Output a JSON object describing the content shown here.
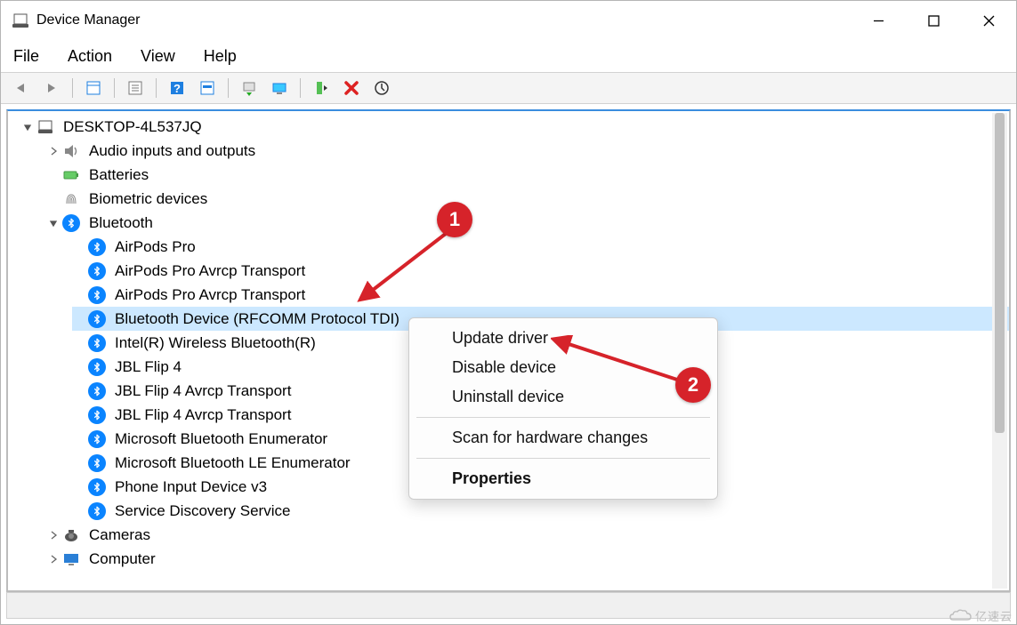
{
  "title": "Device Manager",
  "menubar": [
    "File",
    "Action",
    "View",
    "Help"
  ],
  "root_name": "DESKTOP-4L537JQ",
  "categories": {
    "audio": "Audio inputs and outputs",
    "batteries": "Batteries",
    "biometric": "Biometric devices",
    "bluetooth": "Bluetooth",
    "cameras": "Cameras",
    "computer": "Computer"
  },
  "bluetooth_devices": [
    "AirPods Pro",
    "AirPods Pro Avrcp Transport",
    "AirPods Pro Avrcp Transport",
    "Bluetooth Device (RFCOMM Protocol TDI)",
    "Intel(R) Wireless Bluetooth(R)",
    "JBL Flip 4",
    "JBL Flip 4 Avrcp Transport",
    "JBL Flip 4 Avrcp Transport",
    "Microsoft Bluetooth Enumerator",
    "Microsoft Bluetooth LE Enumerator",
    "Phone Input Device v3",
    "Service Discovery Service"
  ],
  "selected_index": 3,
  "context_menu": {
    "items": [
      "Update driver",
      "Disable device",
      "Uninstall device"
    ],
    "scan": "Scan for hardware changes",
    "properties": "Properties"
  },
  "annotations": {
    "step1": "1",
    "step2": "2"
  },
  "watermark": "亿速云"
}
